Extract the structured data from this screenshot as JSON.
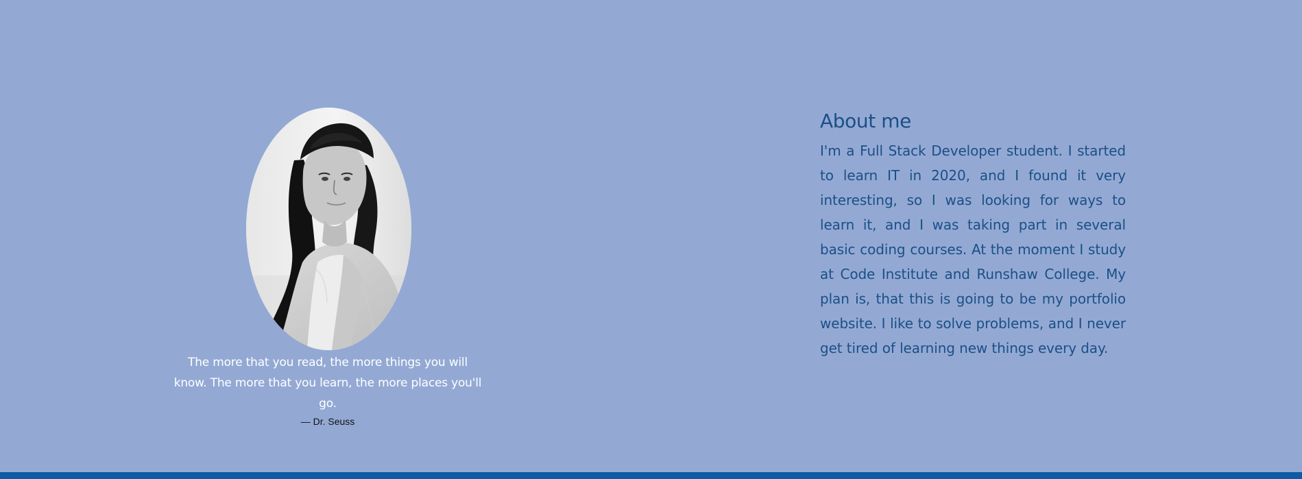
{
  "about": {
    "title": "About me",
    "text": "I'm a Full Stack Developer student. I started to learn IT in 2020, and I found it very interesting, so I was looking for ways to learn it, and I was taking part in several basic coding courses. At the moment I study at Code Institute and Runshaw College. My plan is, that this is going to be my portfolio website. I like to solve problems, and I never get tired of learning new things every day."
  },
  "quote": {
    "text": "The more that you read, the more things you will know. The more that you learn, the more places you'll go.",
    "author": "—  Dr. Seuss"
  },
  "colors": {
    "background": "#93a9d4",
    "heading_text": "#1b4f86",
    "footer_bar": "#0d5aa6",
    "quote_text": "#ffffff"
  },
  "icons": {
    "profile": "portrait-photo"
  }
}
